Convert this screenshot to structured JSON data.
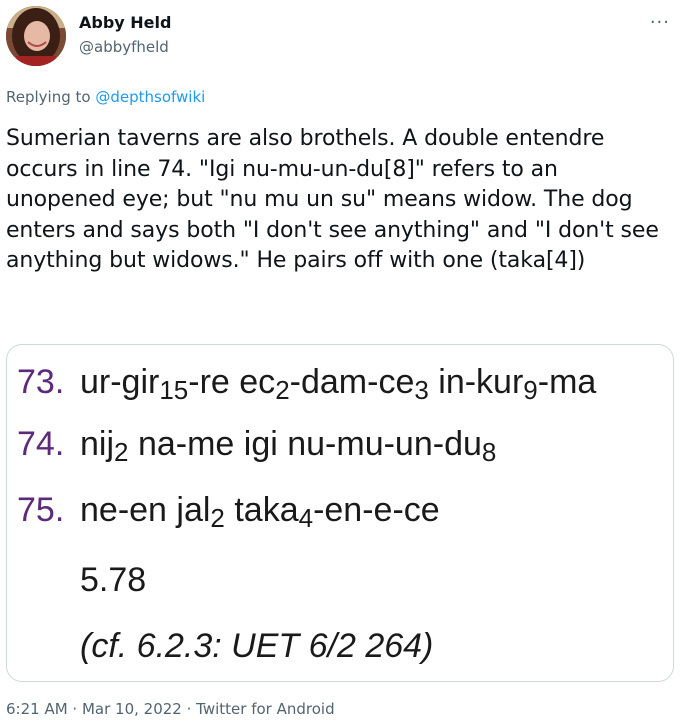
{
  "author": {
    "display_name": "Abby Held",
    "handle": "@abbyfheld"
  },
  "more_icon": "···",
  "reply": {
    "prefix": "Replying to",
    "mention": "@depthsofwiki"
  },
  "tweet_text": "Sumerian taverns are also brothels. A double entendre occurs in line 74. \"Igi nu-mu-un-du[8]\" refers to an unopened eye; but \"nu mu un su\" means widow. The dog enters and says both \"I don't see anything\" and \"I don't see anything but widows.\" He pairs off with one (taka[4])",
  "image": {
    "lines": [
      {
        "num": "73.",
        "parts": [
          {
            "t": "ur-gir"
          },
          {
            "s": "15"
          },
          {
            "t": "-re ec"
          },
          {
            "s": "2"
          },
          {
            "t": "-dam-ce"
          },
          {
            "s": "3"
          },
          {
            "t": " in-kur"
          },
          {
            "s": "9"
          },
          {
            "t": "-ma"
          }
        ]
      },
      {
        "num": "74.",
        "parts": [
          {
            "t": "nij"
          },
          {
            "s": "2"
          },
          {
            "t": " na-me igi nu-mu-un-du"
          },
          {
            "s": "8"
          }
        ]
      },
      {
        "num": "75.",
        "parts": [
          {
            "t": "ne-en jal"
          },
          {
            "s": "2"
          },
          {
            "t": " taka"
          },
          {
            "s": "4"
          },
          {
            "t": "-en-e-ce"
          }
        ]
      }
    ],
    "ref1": "5.78",
    "ref2": "(cf. 6.2.3: UET 6/2 264)"
  },
  "meta": {
    "time": "6:21 AM",
    "sep1": " · ",
    "date": "Mar 10, 2022",
    "sep2": " · ",
    "source": "Twitter for Android"
  }
}
